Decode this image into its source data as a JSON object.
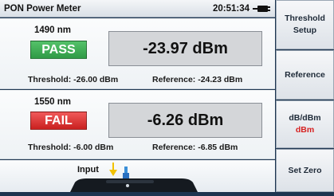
{
  "header": {
    "title": "PON Power Meter",
    "time": "20:51:34"
  },
  "channels": [
    {
      "wavelength": "1490 nm",
      "status": "PASS",
      "power": "-23.97 dBm",
      "threshold": "Threshold: -26.00 dBm",
      "reference": "Reference: -24.23 dBm",
      "status_color": "#2f9a45"
    },
    {
      "wavelength": "1550 nm",
      "status": "FAIL",
      "power": "-6.26 dBm",
      "threshold": "Threshold: -6.00 dBm",
      "reference": "Reference: -6.85 dBm",
      "status_color": "#c9201f"
    }
  ],
  "input": {
    "label": "Input"
  },
  "sidebar": {
    "threshold_setup_line1": "Threshold",
    "threshold_setup_line2": "Setup",
    "reference": "Reference",
    "unit_toggle": "dB/dBm",
    "unit_selected": "dBm",
    "set_zero": "Set Zero"
  },
  "colors": {
    "background": "#1d3550",
    "accent_red": "#d62020"
  }
}
